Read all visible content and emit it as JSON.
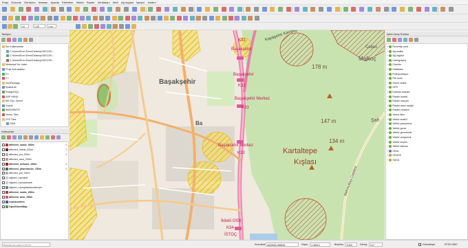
{
  "menu": [
    "Proje",
    "Düzenle",
    "Görünüm",
    "Katman",
    "Ayarlar",
    "Eklentiler",
    "Vektör",
    "Raster",
    "Veritabanı",
    "Web",
    "Ağ örgüsü",
    "İşleyici",
    "Yardım"
  ],
  "toolbar": {
    "scale_field": "10",
    "unit_field": "1.00",
    "second_field": "1 sn"
  },
  "browser_panel": {
    "title": "Tarayıcı",
    "items": [
      {
        "label": "Sık Kullanılanlar",
        "level": 0
      },
      {
        "label": "C:\\Users\\Eren Emre\\Desktop\\GECOD\\...",
        "level": 1
      },
      {
        "label": "C:\\Users\\Eren Emre\\Desktop\\GECOD\\...",
        "level": 1
      },
      {
        "label": "C:\\Users\\Eren Emre\\Desktop\\GECOD\\...",
        "level": 1
      },
      {
        "label": "Mekansal Yer İmleri",
        "level": 0
      },
      {
        "label": "Proje Ana sayfası",
        "level": 0
      },
      {
        "label": "D:\\",
        "level": 0
      },
      {
        "label": "C:\\",
        "level": 0
      },
      {
        "label": "GeoPackage",
        "level": 0
      },
      {
        "label": "SpatiaLite",
        "level": 0
      },
      {
        "label": "PostgreSQL",
        "level": 0
      },
      {
        "label": "SAP HANA",
        "level": 0
      },
      {
        "label": "MS SQL Server",
        "level": 0
      },
      {
        "label": "Oracle",
        "level": 0
      },
      {
        "label": "WMS/WMTS",
        "level": 0
      },
      {
        "label": "Vector Tiles",
        "level": 0
      },
      {
        "label": "XYZ Tiles",
        "level": 0
      },
      {
        "label": "OSM",
        "level": 1
      }
    ]
  },
  "layers_panel": {
    "title": "Katmanlar",
    "layers": [
      {
        "label": "affected_roads_200m",
        "checked": false,
        "color": "#d62828",
        "bold": true,
        "warn": true
      },
      {
        "label": "affected_hotels_200m",
        "checked": false,
        "color": "#7a1d1d",
        "bold": false,
        "warn": true
      },
      {
        "label": "affected_poi_200m",
        "checked": false,
        "color": "#b0b0b0",
        "bold": false,
        "warn": true
      },
      {
        "label": "affected_area_200m",
        "checked": false,
        "color": "#e08a8a",
        "bold": false,
        "warn": false
      },
      {
        "label": "affected_schools_150m",
        "checked": true,
        "color": "#c00000",
        "bold": true,
        "warn": true
      },
      {
        "label": "affected_pharmacies_150m",
        "checked": true,
        "color": "#3a7a2a",
        "bold": true,
        "warn": true
      },
      {
        "label": "affected_poi_150m",
        "checked": false,
        "color": "#b0b0b0",
        "bold": false,
        "warn": false
      },
      {
        "label": "clipped_roproject",
        "checked": false,
        "color": "#cccccc",
        "bold": false,
        "warn": false
      },
      {
        "label": "clipped_roproadmark",
        "checked": false,
        "color": "#cccccc",
        "bold": false,
        "warn": false
      },
      {
        "label": "clipped_roproplacessurfacepo",
        "checked": false,
        "color": "#5a7fbf",
        "bold": false,
        "warn": false
      },
      {
        "label": "affected_roads_150m",
        "checked": true,
        "color": "#d62828",
        "bold": true,
        "warn": false
      },
      {
        "label": "affected_area_150m",
        "checked": true,
        "color": "#d95b5b",
        "bold": true,
        "warn": false
      },
      {
        "label": "roproborders",
        "checked": true,
        "color": "#3060c0",
        "bold": true,
        "warn": false
      },
      {
        "label": "OpenStreetMap",
        "checked": true,
        "color": "#5a9a4a",
        "bold": true,
        "warn": false
      }
    ]
  },
  "processing_panel": {
    "title": "İşlem Araç Kutusu",
    "items": [
      "Recently used",
      "Ağ analizi",
      "Ağ örgüsü",
      "Cartography",
      "Çizimler",
      "Database",
      "Enterpolasyon",
      "File tools",
      "Genel vektör",
      "GPS",
      "Katman araçları",
      "Raster analizi",
      "Raster araçları",
      "Raster arazi analizi",
      "Raster creation",
      "Vector tiles",
      "Vektör analizi",
      "Vektör çakıştırma",
      "Vektör genel",
      "Vektör geometrisi",
      "Vektör oluşturma",
      "Vektör seçimi",
      "Vektör tablosu",
      "GDAL",
      "GRASS",
      "SAGA"
    ]
  },
  "map": {
    "labels": [
      {
        "text": "Başakşehir",
        "cls": "city"
      },
      {
        "text": "Başakşehir",
        "cls": "metro"
      },
      {
        "text": "K32",
        "cls": "metro-code"
      },
      {
        "text": "Başakşehir",
        "cls": "metro"
      },
      {
        "text": "K32",
        "cls": "metro-code"
      },
      {
        "text": "Başakşehir Merkez",
        "cls": "metro"
      },
      {
        "text": "K33",
        "cls": "metro-code"
      },
      {
        "text": "Başakşehir Merkez",
        "cls": "metro"
      },
      {
        "text": "K33",
        "cls": "metro-code"
      },
      {
        "text": "Kartaltepe",
        "cls": "area"
      },
      {
        "text": "Kışlası",
        "cls": "area"
      },
      {
        "text": "178 m",
        "cls": "peak"
      },
      {
        "text": "147 m",
        "cls": "peak"
      },
      {
        "text": "134 m",
        "cls": "peak"
      },
      {
        "text": "Malkoç",
        "cls": "place"
      },
      {
        "text": "Şah",
        "cls": "place"
      },
      {
        "text": "Cebec",
        "cls": "place"
      },
      {
        "text": "Kayaşehir Kavşağı",
        "cls": "street"
      },
      {
        "text": "Mahmutbey Caddesi",
        "cls": "street"
      },
      {
        "text": "Ba",
        "cls": "city"
      },
      {
        "text": "İkitelli OSB",
        "cls": "metro"
      },
      {
        "text": "K34",
        "cls": "metro-code"
      },
      {
        "text": "İSTOÇ",
        "cls": "metro"
      }
    ]
  },
  "statusbar": {
    "search_placeholder": "Bulmak için yazın (Ctrl+K)",
    "coord_label": "Koordinat",
    "coord_value": "4632626,396815",
    "scale_label": "Ölçek",
    "scale_value": "1:38310",
    "magnifier_label": "Büyüteç",
    "magnifier_value": "%100",
    "rotation_label": "Dönüş",
    "rotation_value": "0.0 °",
    "render_label": "Görselleştir",
    "crs": "EPSG:3857"
  },
  "colors": {
    "park": "#c9e3b0",
    "buffer_yellow": "#f5d64a",
    "buffer_red": "#d33",
    "road_main": "#f0a7c4",
    "road_secondary": "#f6c98e",
    "residential": "#e0dcd4",
    "water": "#a9cde8"
  }
}
